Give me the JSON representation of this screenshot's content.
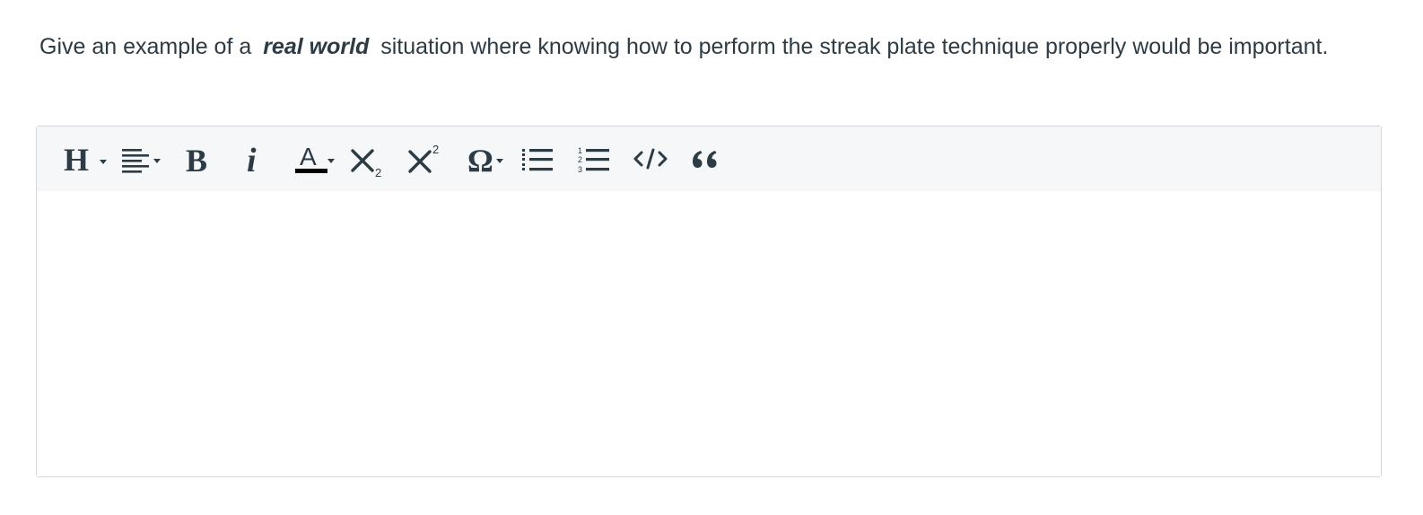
{
  "question": {
    "text_before": "Give an example of a",
    "text_emphasis": "real world",
    "text_after": "situation where knowing how to perform the streak plate technique properly would be important."
  },
  "toolbar": {
    "buttons": [
      {
        "name": "heading-dropdown",
        "icon": "heading-icon"
      },
      {
        "name": "align-dropdown",
        "icon": "align-left-icon"
      },
      {
        "name": "bold",
        "icon": "bold-icon"
      },
      {
        "name": "italic",
        "icon": "italic-icon"
      },
      {
        "name": "text-color-dropdown",
        "icon": "text-color-icon"
      },
      {
        "name": "subscript",
        "icon": "subscript-icon"
      },
      {
        "name": "superscript",
        "icon": "superscript-icon"
      },
      {
        "name": "special-characters-dropdown",
        "icon": "omega-icon"
      },
      {
        "name": "bulleted-list",
        "icon": "bulleted-list-icon"
      },
      {
        "name": "numbered-list",
        "icon": "numbered-list-icon"
      },
      {
        "name": "code",
        "icon": "code-icon"
      },
      {
        "name": "blockquote",
        "icon": "quote-icon"
      }
    ]
  },
  "editor": {
    "content": ""
  },
  "colors": {
    "text": "#2d3b45",
    "toolbar_bg": "#f6f7f8",
    "border": "#d4d8dc"
  }
}
